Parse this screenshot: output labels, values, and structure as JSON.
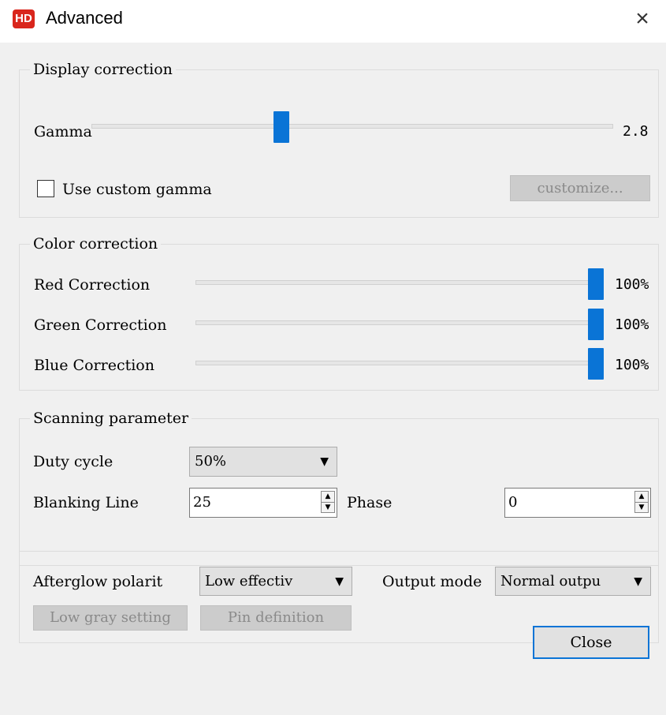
{
  "window": {
    "icon_text": "HD",
    "title": "Advanced",
    "close_glyph": "×"
  },
  "display_correction": {
    "legend": "Display correction",
    "gamma_label": "Gamma",
    "gamma_value": "2.8",
    "use_custom_gamma_label": "Use custom gamma",
    "use_custom_gamma_checked": false,
    "customize_label": "customize..."
  },
  "color_correction": {
    "legend": "Color correction",
    "items": [
      {
        "label": "Red Correction",
        "value": "100%"
      },
      {
        "label": "Green Correction",
        "value": "100%"
      },
      {
        "label": "Blue Correction",
        "value": "100%"
      }
    ]
  },
  "scanning": {
    "legend": "Scanning parameter",
    "duty_cycle_label": "Duty cycle",
    "duty_cycle_value": "50%",
    "blanking_line_label": "Blanking Line",
    "blanking_line_value": "25",
    "phase_label": "Phase",
    "phase_value": "0"
  },
  "misc": {
    "afterglow_label": "Afterglow polarit",
    "afterglow_value": "Low effectiv",
    "output_mode_label": "Output mode",
    "output_mode_value": "Normal outpu",
    "low_gray_label": "Low gray setting",
    "pin_definition_label": "Pin definition"
  },
  "footer": {
    "close_label": "Close"
  },
  "icons": {
    "dropdown_arrow": "▼",
    "spin_up": "▲",
    "spin_down": "▼"
  },
  "colors": {
    "accent": "#0a74d6",
    "app_icon": "#d9261c"
  }
}
